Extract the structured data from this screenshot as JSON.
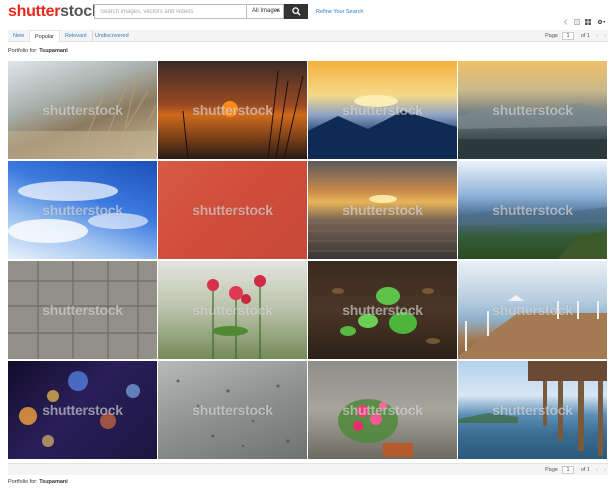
{
  "header": {
    "logo_part1": "shutter",
    "logo_part2": "stock",
    "search_placeholder": "Search images, vectors and videos",
    "search_type": "All Images",
    "refine_label": "Refine Your Search"
  },
  "toolbar": {
    "icons": [
      "back-icon",
      "list-view-icon",
      "grid-view-icon",
      "settings-icon"
    ]
  },
  "tabs": [
    {
      "label": "New"
    },
    {
      "label": "Popular"
    },
    {
      "label": "Relevant"
    },
    {
      "label": "Undiscovered"
    }
  ],
  "pager": {
    "page_label": "Page",
    "page_value": "1",
    "of_label": "of 1",
    "prev": "‹",
    "next": "›"
  },
  "portfolio": {
    "prefix": "Portfolio for:",
    "name": "Tsupamani"
  },
  "watermark": "shutterstock",
  "images": [
    {
      "subject": "dry grass field"
    },
    {
      "subject": "sunset silhouette grass"
    },
    {
      "subject": "sunset over mountains"
    },
    {
      "subject": "misty mountain landscape"
    },
    {
      "subject": "blue sky with clouds"
    },
    {
      "subject": "red paper texture"
    },
    {
      "subject": "sunset over sea"
    },
    {
      "subject": "sea and green hills"
    },
    {
      "subject": "cracked concrete tiles"
    },
    {
      "subject": "red flowers on green"
    },
    {
      "subject": "green leaves on soil"
    },
    {
      "subject": "wooden pier over sea"
    },
    {
      "subject": "blurred city lights"
    },
    {
      "subject": "rain drops on glass"
    },
    {
      "subject": "pink flower by wall"
    },
    {
      "subject": "old pier on beach"
    }
  ]
}
